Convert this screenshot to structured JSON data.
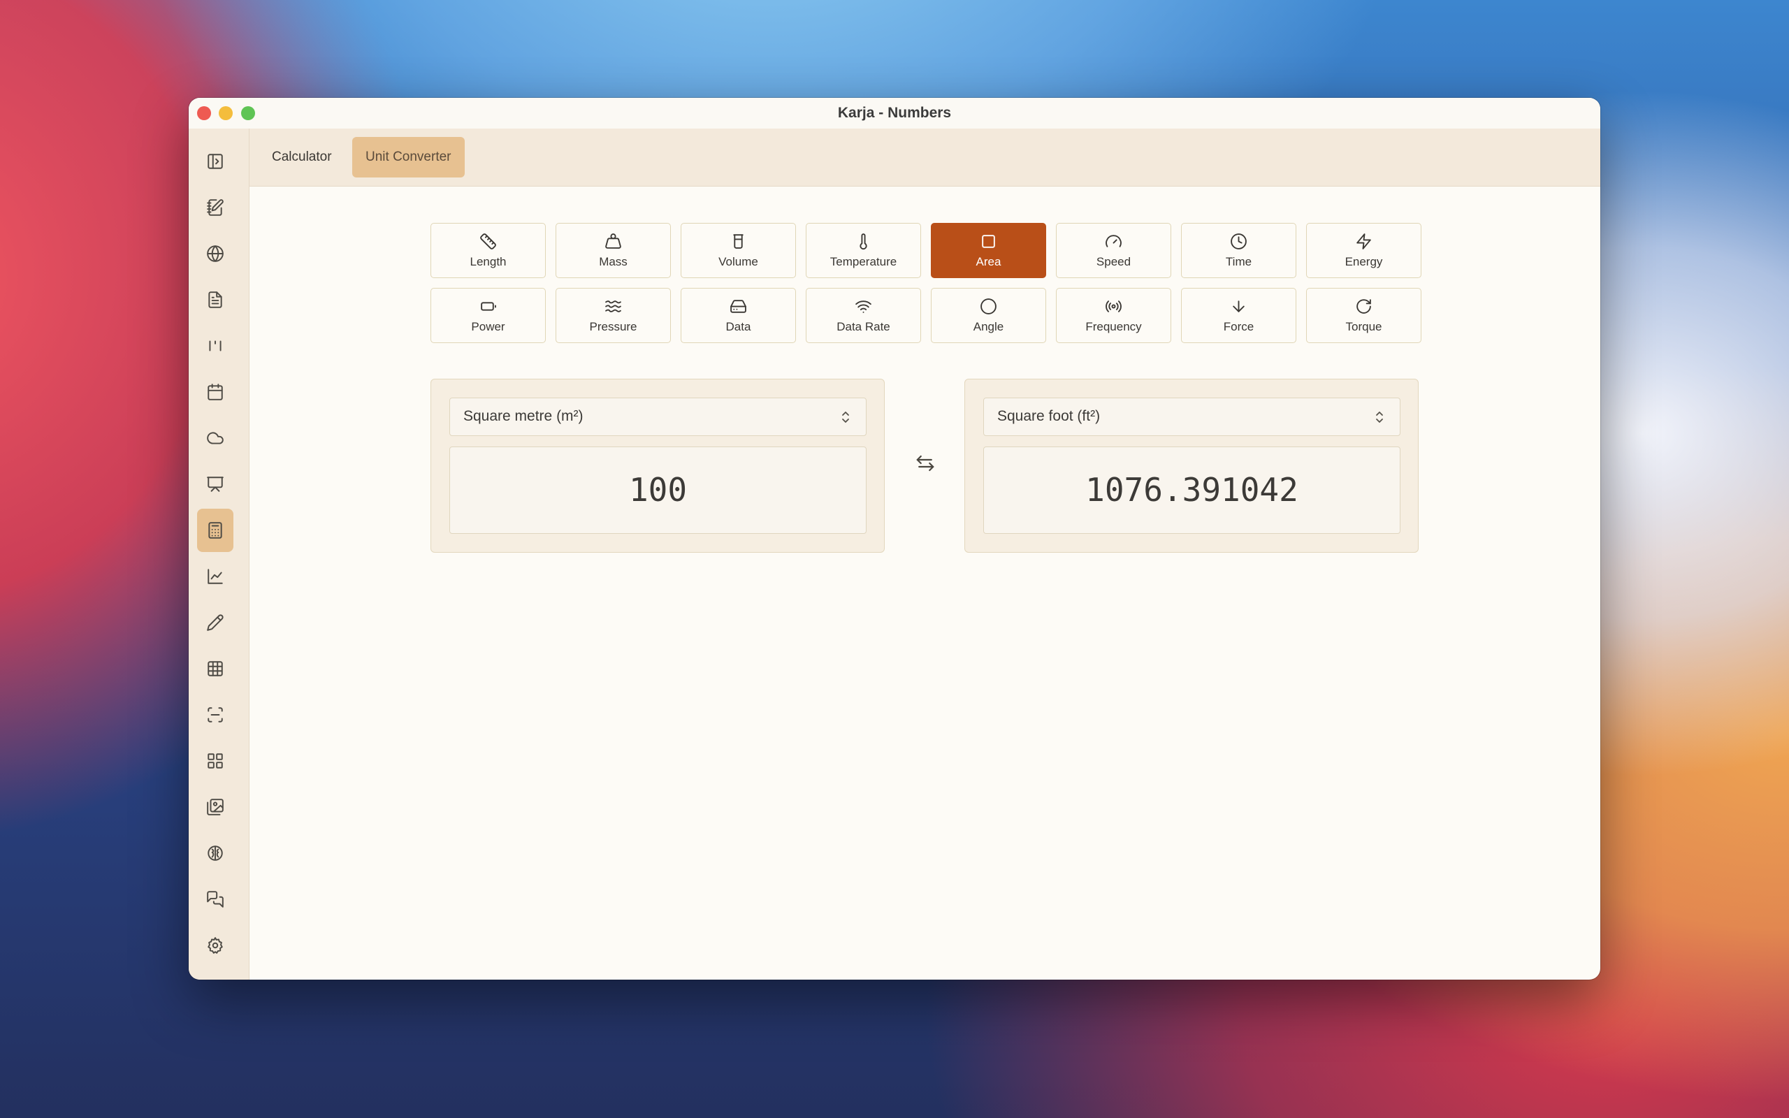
{
  "window": {
    "title": "Karja - Numbers"
  },
  "tabs": [
    {
      "label": "Calculator",
      "active": false
    },
    {
      "label": "Unit Converter",
      "active": true
    }
  ],
  "sidebar": {
    "items": [
      {
        "icon": "sidebar-toggle-icon"
      },
      {
        "icon": "notebook-pen-icon"
      },
      {
        "icon": "globe-icon"
      },
      {
        "icon": "document-icon"
      },
      {
        "icon": "text-cursor-icon"
      },
      {
        "icon": "calendar-icon"
      },
      {
        "icon": "cloud-icon"
      },
      {
        "icon": "presentation-icon"
      },
      {
        "icon": "calculator-icon",
        "active": true
      },
      {
        "icon": "line-chart-icon"
      },
      {
        "icon": "pencil-icon"
      },
      {
        "icon": "table-icon"
      },
      {
        "icon": "scan-icon"
      },
      {
        "icon": "grid-icon"
      },
      {
        "icon": "images-icon"
      },
      {
        "icon": "brain-icon"
      },
      {
        "icon": "messages-icon"
      },
      {
        "icon": "settings-icon"
      }
    ]
  },
  "categories": [
    {
      "label": "Length",
      "icon": "ruler-icon"
    },
    {
      "label": "Mass",
      "icon": "weight-icon"
    },
    {
      "label": "Volume",
      "icon": "cylinder-icon"
    },
    {
      "label": "Temperature",
      "icon": "thermometer-icon"
    },
    {
      "label": "Area",
      "icon": "square-icon",
      "active": true
    },
    {
      "label": "Speed",
      "icon": "gauge-icon"
    },
    {
      "label": "Time",
      "icon": "clock-icon"
    },
    {
      "label": "Energy",
      "icon": "zap-icon"
    },
    {
      "label": "Power",
      "icon": "battery-icon"
    },
    {
      "label": "Pressure",
      "icon": "waves-icon"
    },
    {
      "label": "Data",
      "icon": "hard-drive-icon"
    },
    {
      "label": "Data Rate",
      "icon": "wifi-icon"
    },
    {
      "label": "Angle",
      "icon": "circle-icon"
    },
    {
      "label": "Frequency",
      "icon": "radio-icon"
    },
    {
      "label": "Force",
      "icon": "arrow-down-icon"
    },
    {
      "label": "Torque",
      "icon": "rotate-cw-icon"
    }
  ],
  "converter": {
    "from": {
      "unit": "Square metre (m²)",
      "value": "100"
    },
    "to": {
      "unit": "Square foot (ft²)",
      "value": "1076.391042"
    }
  },
  "colors": {
    "accent": "#b94f18",
    "highlight": "#e7c191",
    "panel": "#f6eee1"
  }
}
